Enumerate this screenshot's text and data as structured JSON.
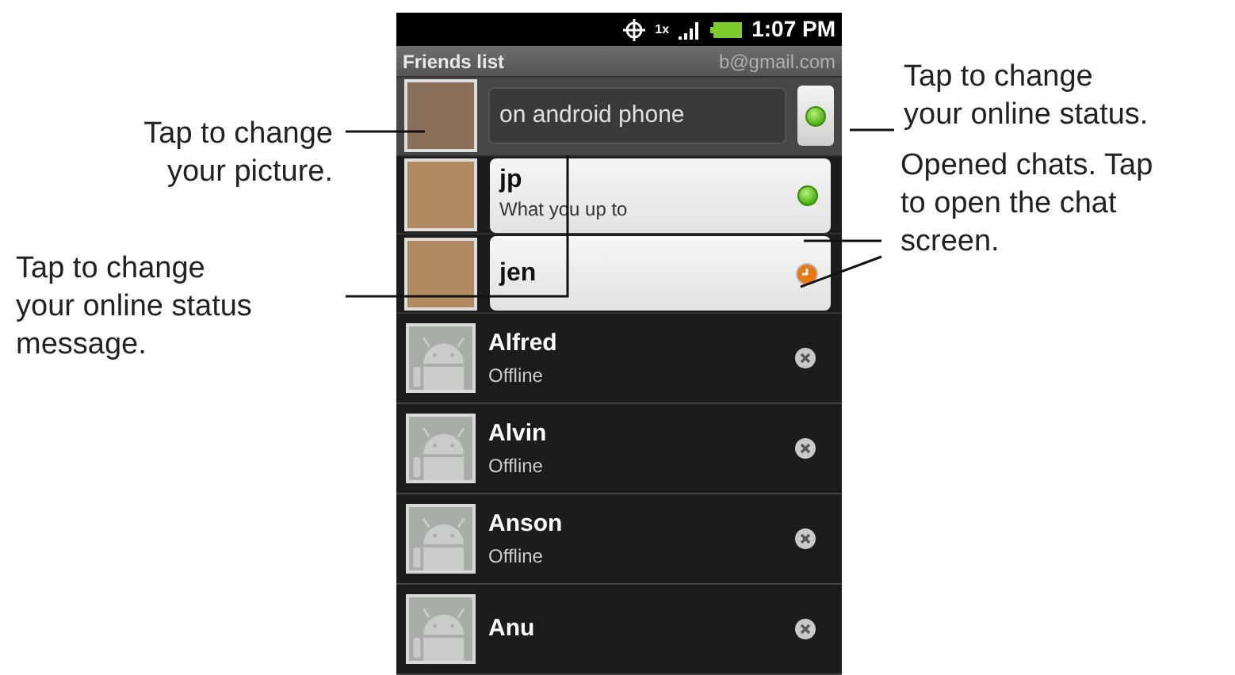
{
  "status_bar": {
    "network": "1x",
    "time": "1:07 PM"
  },
  "header": {
    "title": "Friends list",
    "account": "b@gmail.com"
  },
  "me": {
    "status_message": "on android phone",
    "kind": "online"
  },
  "chats": [
    {
      "name": "jp",
      "message": "What you up to",
      "kind": "online"
    },
    {
      "name": "jen",
      "kind": "away"
    }
  ],
  "friends": [
    {
      "name": "Alfred",
      "status_text": "Offline",
      "kind": "offline"
    },
    {
      "name": "Alvin",
      "status_text": "Offline",
      "kind": "offline"
    },
    {
      "name": "Anson",
      "status_text": "Offline",
      "kind": "offline"
    },
    {
      "name": "Anu",
      "kind": "offline"
    }
  ],
  "callouts": [
    {
      "lines": [
        "Tap to change",
        "your picture."
      ]
    },
    {
      "lines": [
        "Tap to change",
        "your online status",
        "message."
      ]
    },
    {
      "lines": [
        "Tap to change",
        "your online status."
      ]
    },
    {
      "lines": [
        "Opened chats. Tap",
        "to open the chat",
        "screen."
      ]
    }
  ]
}
